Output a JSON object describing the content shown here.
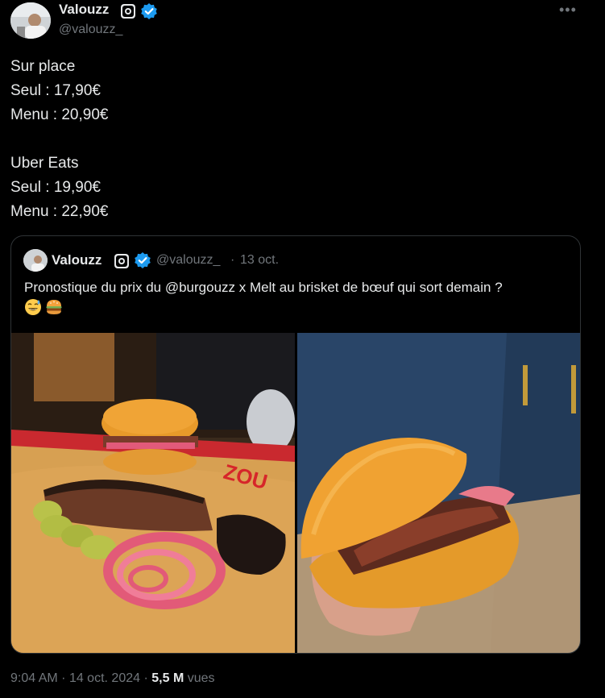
{
  "author": {
    "name": "Valouzz",
    "handle": "@valouzz_"
  },
  "tweet": {
    "lines": [
      "Sur place",
      "Seul : 17,90€",
      "Menu : 20,90€",
      "",
      "Uber Eats",
      "Seul : 19,90€",
      "Menu : 22,90€"
    ]
  },
  "quote": {
    "name": "Valouzz",
    "handle": "@valouzz_",
    "separator": "·",
    "date": "13 oct.",
    "text": "Pronostique du prix du @burgouzz x Melt au brisket de bœuf qui sort demain ?",
    "emojis": [
      "sweat-smile-emoji",
      "burger-emoji"
    ]
  },
  "footer": {
    "time": "9:04 AM",
    "separator": "·",
    "date": "14 oct. 2024",
    "views_count": "5,5 M",
    "views_label": "vues"
  },
  "colors": {
    "background": "#000000",
    "text": "#e7e9ea",
    "muted": "#71767b",
    "verified": "#1d9bf0",
    "border": "#2f3336"
  },
  "icons": [
    "eye-badge-icon",
    "verified-badge-icon",
    "more-icon"
  ]
}
